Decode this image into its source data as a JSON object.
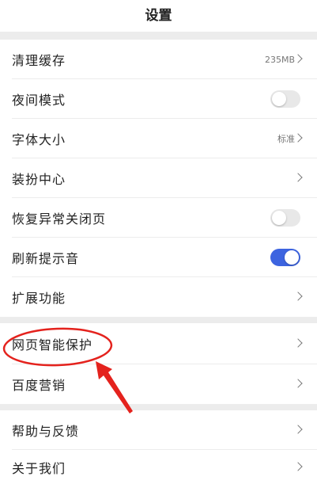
{
  "header": {
    "title": "设置"
  },
  "colors": {
    "toggle_on": "#3d64e0",
    "toggle_off": "#e8e8e8",
    "annotation": "#e4221d"
  },
  "items": [
    {
      "label": "清理缓存",
      "value": "235MB",
      "control": "chevron"
    },
    {
      "label": "夜间模式",
      "control": "toggle",
      "on": false
    },
    {
      "label": "字体大小",
      "value": "标准",
      "control": "chevron"
    },
    {
      "label": "装扮中心",
      "control": "chevron"
    },
    {
      "label": "恢复异常关闭页",
      "control": "toggle",
      "on": false
    },
    {
      "label": "刷新提示音",
      "control": "toggle",
      "on": true
    },
    {
      "label": "扩展功能",
      "control": "chevron"
    },
    {
      "label": "网页智能保护",
      "control": "chevron",
      "highlighted": true
    },
    {
      "label": "百度营销",
      "control": "chevron"
    },
    {
      "label": "帮助与反馈",
      "control": "chevron"
    },
    {
      "label": "关于我们",
      "control": "chevron"
    }
  ]
}
